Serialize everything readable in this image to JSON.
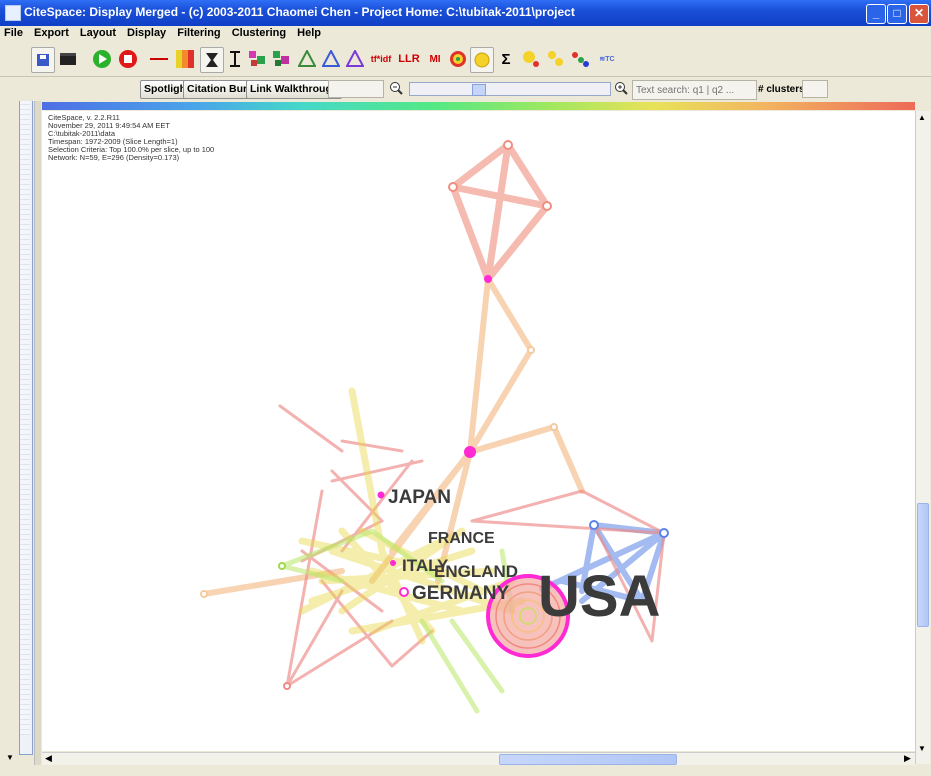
{
  "window": {
    "title": "CiteSpace: Display Merged - (c) 2003-2011 Chaomei Chen - Project Home: C:\\tubitak-2011\\project"
  },
  "menu": [
    "File",
    "Export",
    "Layout",
    "Display",
    "Filtering",
    "Clustering",
    "Help"
  ],
  "toolbar": {
    "tfidf_label": "tf*idf",
    "llr_label": "LLR",
    "mi_label": "MI",
    "sigma_label": "Σ"
  },
  "controls": {
    "spotlight": "Spotlight",
    "citation_burst": "Citation Burst",
    "link_walkthrough": "Link Walkthrough",
    "text_search_placeholder": "Text search: q1 | q2 ...",
    "clusters_label": "# clusters"
  },
  "info": {
    "version": "CiteSpace, v. 2.2.R11",
    "date": "November 29, 2011 9:49:54 AM EET",
    "path": "C:\\tubitak-2011\\data",
    "timespan": "Timespan: 1972-2009 (Slice Length=1)",
    "criteria": "Selection Criteria: Top 100.0% per slice, up to 100",
    "network": "Network: N=59, E=296 (Density=0.173)"
  },
  "labels": {
    "japan": "JAPAN",
    "france": "FRANCE",
    "italy": "ITALY",
    "england": "ENGLAND",
    "germany": "GERMANY",
    "usa": "USA"
  },
  "colors": {
    "title_bar": "#0f3fc6",
    "usa_cluster": "#5b84e8",
    "hub_node": "#ff2ad4"
  }
}
